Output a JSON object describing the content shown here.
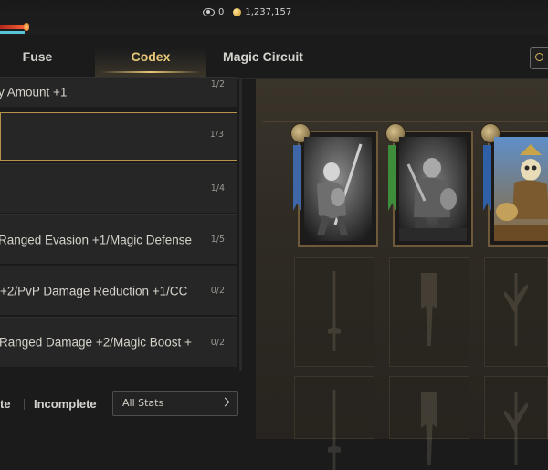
{
  "currency": {
    "watch_count": "0",
    "gold": "1,237,157"
  },
  "tabs": [
    {
      "label": "Fuse",
      "active": false
    },
    {
      "label": "Codex",
      "active": true
    },
    {
      "label": "Magic Circuit",
      "active": false
    }
  ],
  "codex_list": [
    {
      "label": "y Amount +1",
      "count": "1/2",
      "selected": false
    },
    {
      "label": "",
      "count": "1/3",
      "selected": true
    },
    {
      "label": "",
      "count": "1/4",
      "selected": false
    },
    {
      "label": "Ranged Evasion +1/Magic Defense",
      "count": "1/5",
      "selected": false
    },
    {
      "label": "+2/PvP Damage Reduction +1/CC",
      "count": "0/2",
      "selected": false
    },
    {
      "label": "Ranged Damage +2/Magic Boost +",
      "count": "0/2",
      "selected": false
    }
  ],
  "filter": {
    "complete_label": "te",
    "incomplete_label": "Incomplete",
    "stat_filter": "All Stats"
  },
  "colors": {
    "accent_gold": "#e9c979",
    "selected_border": "#b8924a",
    "background": "#1b1b1c"
  },
  "icons": {
    "watch": "eye-icon",
    "gold": "coin-icon",
    "search": "search-icon",
    "dropdown": "chevron-right-icon"
  }
}
